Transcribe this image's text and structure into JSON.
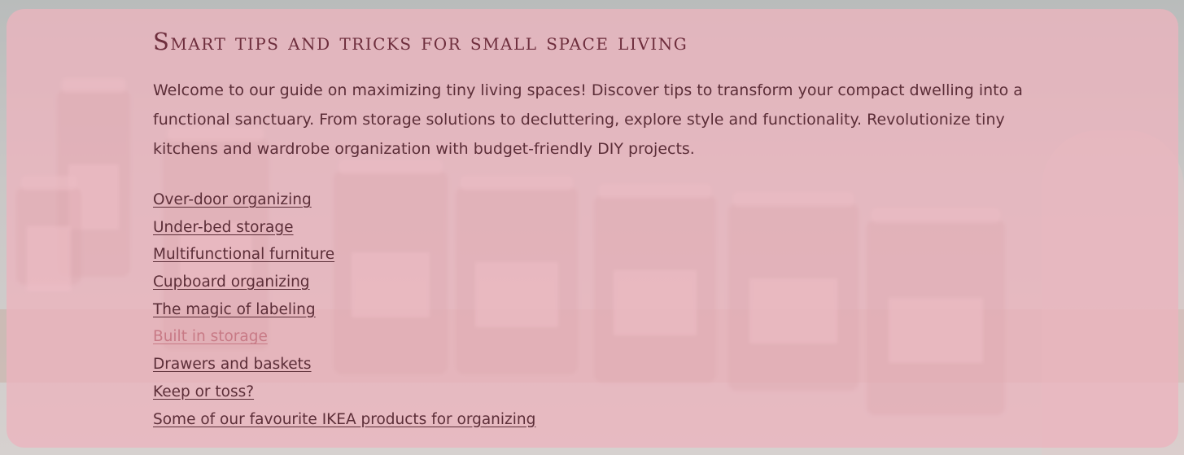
{
  "title": "Smart tips and tricks for small space living",
  "intro": "Welcome to our guide on maximizing tiny living spaces! Discover tips to transform your compact dwelling into a functional sanctuary. From storage solutions to decluttering, explore style and functionality. Revolutionize tiny kitchens and wardrobe organization with budget-friendly DIY projects.",
  "links": [
    {
      "label": "Over-door organizing"
    },
    {
      "label": "Under-bed storage"
    },
    {
      "label": "Multifunctional furniture"
    },
    {
      "label": "Cupboard organizing"
    },
    {
      "label": "The magic of labeling"
    },
    {
      "label": "Built in storage"
    },
    {
      "label": "Drawers and baskets"
    },
    {
      "label": "Keep or toss?"
    },
    {
      "label": "Some of our favourite IKEA products for organizing"
    }
  ],
  "colors": {
    "panel": "#ecb4be",
    "text": "#5c2e38",
    "title": "#6e2e3d",
    "visited_link": "#c87a86"
  }
}
